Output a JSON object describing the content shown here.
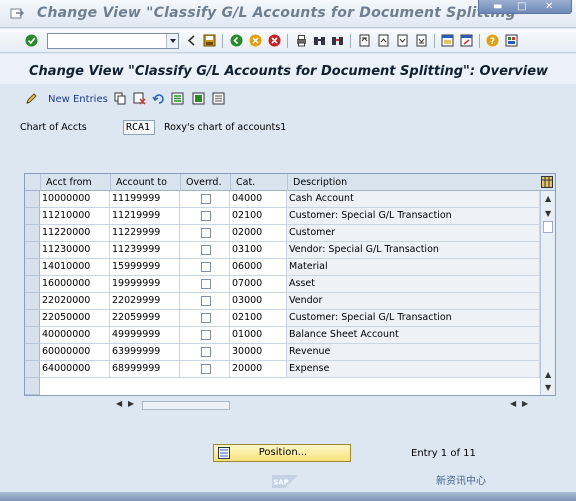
{
  "window": {
    "title": "Change View \"Classify G/L Accounts for Document Splitting\""
  },
  "toolbar": {
    "command_field_value": ""
  },
  "screen": {
    "title": "Change View \"Classify G/L Accounts for Document Splitting\": Overview"
  },
  "app_toolbar": {
    "new_entries_label": "New Entries"
  },
  "chart_of_accounts": {
    "label": "Chart of Accts",
    "value": "RCA1",
    "description": "Roxy's chart of accounts1"
  },
  "table": {
    "columns": [
      "Acct from",
      "Account to",
      "Overrd.",
      "Cat.",
      "Description"
    ],
    "rows": [
      {
        "from": "10000000",
        "to": "11199999",
        "overrd": false,
        "cat": "04000",
        "desc": "Cash Account"
      },
      {
        "from": "11210000",
        "to": "11219999",
        "overrd": false,
        "cat": "02100",
        "desc": "Customer: Special G/L Transaction"
      },
      {
        "from": "11220000",
        "to": "11229999",
        "overrd": false,
        "cat": "02000",
        "desc": "Customer"
      },
      {
        "from": "11230000",
        "to": "11239999",
        "overrd": false,
        "cat": "03100",
        "desc": "Vendor: Special G/L Transaction"
      },
      {
        "from": "14010000",
        "to": "15999999",
        "overrd": false,
        "cat": "06000",
        "desc": "Material"
      },
      {
        "from": "16000000",
        "to": "19999999",
        "overrd": false,
        "cat": "07000",
        "desc": "Asset"
      },
      {
        "from": "22020000",
        "to": "22029999",
        "overrd": false,
        "cat": "03000",
        "desc": "Vendor"
      },
      {
        "from": "22050000",
        "to": "22059999",
        "overrd": false,
        "cat": "02100",
        "desc": "Customer: Special G/L Transaction"
      },
      {
        "from": "40000000",
        "to": "49999999",
        "overrd": false,
        "cat": "01000",
        "desc": "Balance Sheet Account"
      },
      {
        "from": "60000000",
        "to": "63999999",
        "overrd": false,
        "cat": "30000",
        "desc": "Revenue"
      },
      {
        "from": "64000000",
        "to": "68999999",
        "overrd": false,
        "cat": "20000",
        "desc": "Expense"
      }
    ]
  },
  "position_button": {
    "label": "Position..."
  },
  "entry_info": "Entry 1 of 11",
  "watermark": "新资讯中心",
  "colors": {
    "accent": "#1d3c88",
    "table_header": "#d8e3ee",
    "button": "#f6e27a"
  }
}
